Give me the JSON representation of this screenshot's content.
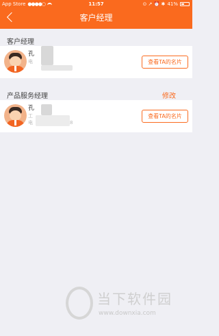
{
  "status_bar": {
    "carrier": "App Store",
    "signal": "●●●●○",
    "time": "11:57",
    "icons": "⊙ ↗ ⏰ ✱",
    "battery": "41%",
    "battery_level": 0.41
  },
  "header": {
    "title": "客户经理",
    "back_icon": "chevron-left-icon"
  },
  "sections": [
    {
      "title": "客户经理",
      "action": "",
      "card": {
        "name": "孔",
        "line1": "",
        "line2": "电",
        "button": "查看TA的名片"
      }
    },
    {
      "title": "产品服务经理",
      "action": "修改",
      "card": {
        "name": "孔",
        "line1": "工",
        "line2": "电",
        "tail": "8",
        "button": "查看TA的名片"
      }
    }
  ],
  "watermark": {
    "brand": "当下软件园",
    "url": "www.downxia.com"
  },
  "colors": {
    "accent": "#fa6a1e",
    "background": "#efeff4"
  }
}
